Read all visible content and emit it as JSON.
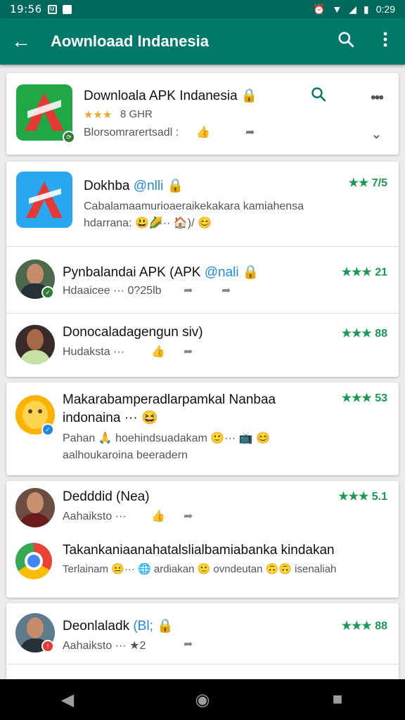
{
  "status_bar": {
    "time": "19:56",
    "notif": "M",
    "right_time": "0:29"
  },
  "app_bar": {
    "title": "Aownloaad Indanesia"
  },
  "app_card": {
    "title": "Downloala APK Indanesia 🔒",
    "stars": "★★★",
    "meta": "8 GHR",
    "subtitle": "Blorsomrarertsadl :"
  },
  "items": [
    {
      "title": "Dokhba",
      "tag": "@nlli",
      "rating": "★★ 7/5",
      "desc": "Cabalamaamurioaeraikekakara kamiahensa hdarrana: 😃🌽·· 🏠)/ 😊"
    },
    {
      "title": "Pynbalandai APK (APK",
      "tag": "@nali",
      "rating": "★★★ 21",
      "sub": "Hdaaicee ··· 0?25lb"
    },
    {
      "title": "Donocaladagengun siv)",
      "rating": "★★★ 88",
      "sub": "Hudaksta ··· "
    },
    {
      "title": "Makarabamperadlarpamkal Nanbaa indonaina ··· 😆",
      "rating": "★★★ 53",
      "desc": "Pahan 🙏 hoehindsuadakam 🙂··· 📺 😊 aalhoukaroina beeradern"
    },
    {
      "title": "Dedddid (Nea)",
      "rating": "★★★ 5.1",
      "sub": "Aahaiksto ··· "
    },
    {
      "title": "Takankaniaanahatalslialbamiabanka kindakan",
      "desc": "Terlainam 😐··· 🌐 ardiakan 🙂 ovndeutan 🙃🙃 isenaliah"
    },
    {
      "title": "Deonlaladk",
      "tag": "(Bl;",
      "rating": "★★★ 88",
      "sub": "Aahaiksto ··· ★2"
    }
  ],
  "colors": {
    "appbar": "#00796b",
    "statusbar": "#00695c",
    "rating": "#1a9a52",
    "tag": "#1e88e5"
  }
}
